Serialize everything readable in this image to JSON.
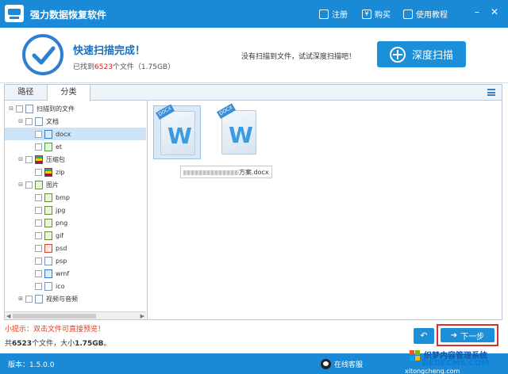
{
  "titlebar": {
    "title": "强力数据恢复软件",
    "register": "注册",
    "buy": "购买",
    "tutorial": "使用教程",
    "buy_icon": "¥"
  },
  "header": {
    "done_title": "快速扫描完成！",
    "found_prefix": "已找到",
    "found_count": "6523",
    "found_suffix": "个文件（1.75GB）",
    "tip": "没有扫描到文件，试试深度扫描吧！",
    "deep_scan": "深度扫描"
  },
  "tabs": [
    "路径",
    "分类"
  ],
  "tree": [
    {
      "label": "扫描到的文件",
      "level": 0,
      "exp": "⊟",
      "icon": "doc"
    },
    {
      "label": "文档",
      "level": 1,
      "exp": "⊟",
      "icon": "doc"
    },
    {
      "label": "docx",
      "level": 2,
      "exp": "",
      "icon": "blue",
      "selected": true
    },
    {
      "label": "et",
      "level": 2,
      "exp": "",
      "icon": "green"
    },
    {
      "label": "压缩包",
      "level": 1,
      "exp": "⊟",
      "icon": "zip"
    },
    {
      "label": "zip",
      "level": 2,
      "exp": "",
      "icon": "zip"
    },
    {
      "label": "图片",
      "level": 1,
      "exp": "⊟",
      "icon": "img"
    },
    {
      "label": "bmp",
      "level": 2,
      "exp": "",
      "icon": "img"
    },
    {
      "label": "jpg",
      "level": 2,
      "exp": "",
      "icon": "img"
    },
    {
      "label": "png",
      "level": 2,
      "exp": "",
      "icon": "img"
    },
    {
      "label": "gif",
      "level": 2,
      "exp": "",
      "icon": "img"
    },
    {
      "label": "psd",
      "level": 2,
      "exp": "",
      "icon": "red"
    },
    {
      "label": "psp",
      "level": 2,
      "exp": "",
      "icon": "doc"
    },
    {
      "label": "wmf",
      "level": 2,
      "exp": "",
      "icon": "blue"
    },
    {
      "label": "ico",
      "level": 2,
      "exp": "",
      "icon": "doc"
    },
    {
      "label": "视频与音频",
      "level": 1,
      "exp": "⊞",
      "icon": "doc"
    }
  ],
  "files": [
    {
      "badge": "DOCX",
      "glyph": "W",
      "name": ""
    },
    {
      "badge": "DOCX",
      "glyph": "W",
      "name": "方案.docx"
    }
  ],
  "footer": {
    "hint": "小提示：双击文件可直接预览！",
    "total_prefix": "共",
    "total_count": "6523",
    "total_mid": "个文件，大小",
    "total_size": "1.75GB",
    "total_suffix": "。",
    "back": "↶",
    "next": "下一步"
  },
  "statusbar": {
    "version": "版本：1.5.0.0",
    "service": "在线客服"
  },
  "watermark": {
    "line1": "织梦内容管理系统",
    "line2": "DEDECMS.COM",
    "line3": "xitongcheng.com"
  },
  "colors": {
    "brand": "#1a8ad6",
    "accent_red": "#e02020"
  }
}
